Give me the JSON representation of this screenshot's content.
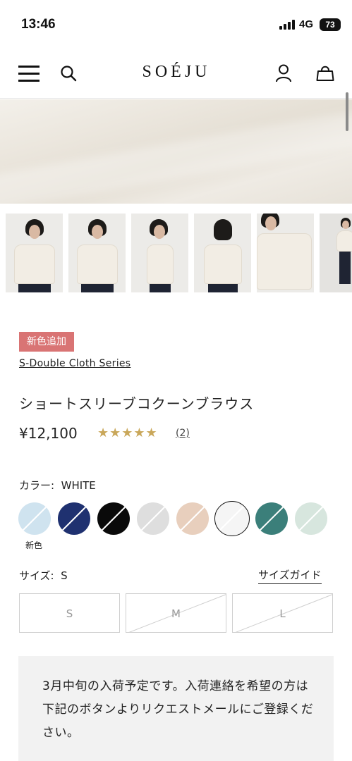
{
  "status_bar": {
    "time": "13:46",
    "network": "4G",
    "battery": "73"
  },
  "header": {
    "logo": "SOÉJU"
  },
  "product": {
    "badge": "新色追加",
    "series": "S-Double Cloth Series",
    "title": "ショートスリーブコクーンブラウス",
    "price": "¥12,100",
    "rating": 5,
    "stars": "★★★★★",
    "review_count": "(2)"
  },
  "color": {
    "label": "カラー:",
    "selected": "WHITE",
    "new_label": "新色",
    "swatches": [
      {
        "name": "light-blue",
        "hex": "#cfe3ef"
      },
      {
        "name": "navy",
        "hex": "#1f3170"
      },
      {
        "name": "black",
        "hex": "#0a0a0a"
      },
      {
        "name": "light-gray",
        "hex": "#dedede"
      },
      {
        "name": "beige",
        "hex": "#e8cfbd"
      },
      {
        "name": "white",
        "hex": "#f5f5f5"
      },
      {
        "name": "teal",
        "hex": "#3b7f7a"
      },
      {
        "name": "mint",
        "hex": "#d7e6de"
      }
    ]
  },
  "size": {
    "label": "サイズ:",
    "selected": "S",
    "guide": "サイズガイド",
    "options": [
      {
        "label": "S",
        "available": true
      },
      {
        "label": "M",
        "available": false
      },
      {
        "label": "L",
        "available": false
      }
    ]
  },
  "notice": {
    "text": "3月中旬の入荷予定です。入荷連絡を希望の方は下記のボタンよりリクエストメールにご登録ください。"
  }
}
